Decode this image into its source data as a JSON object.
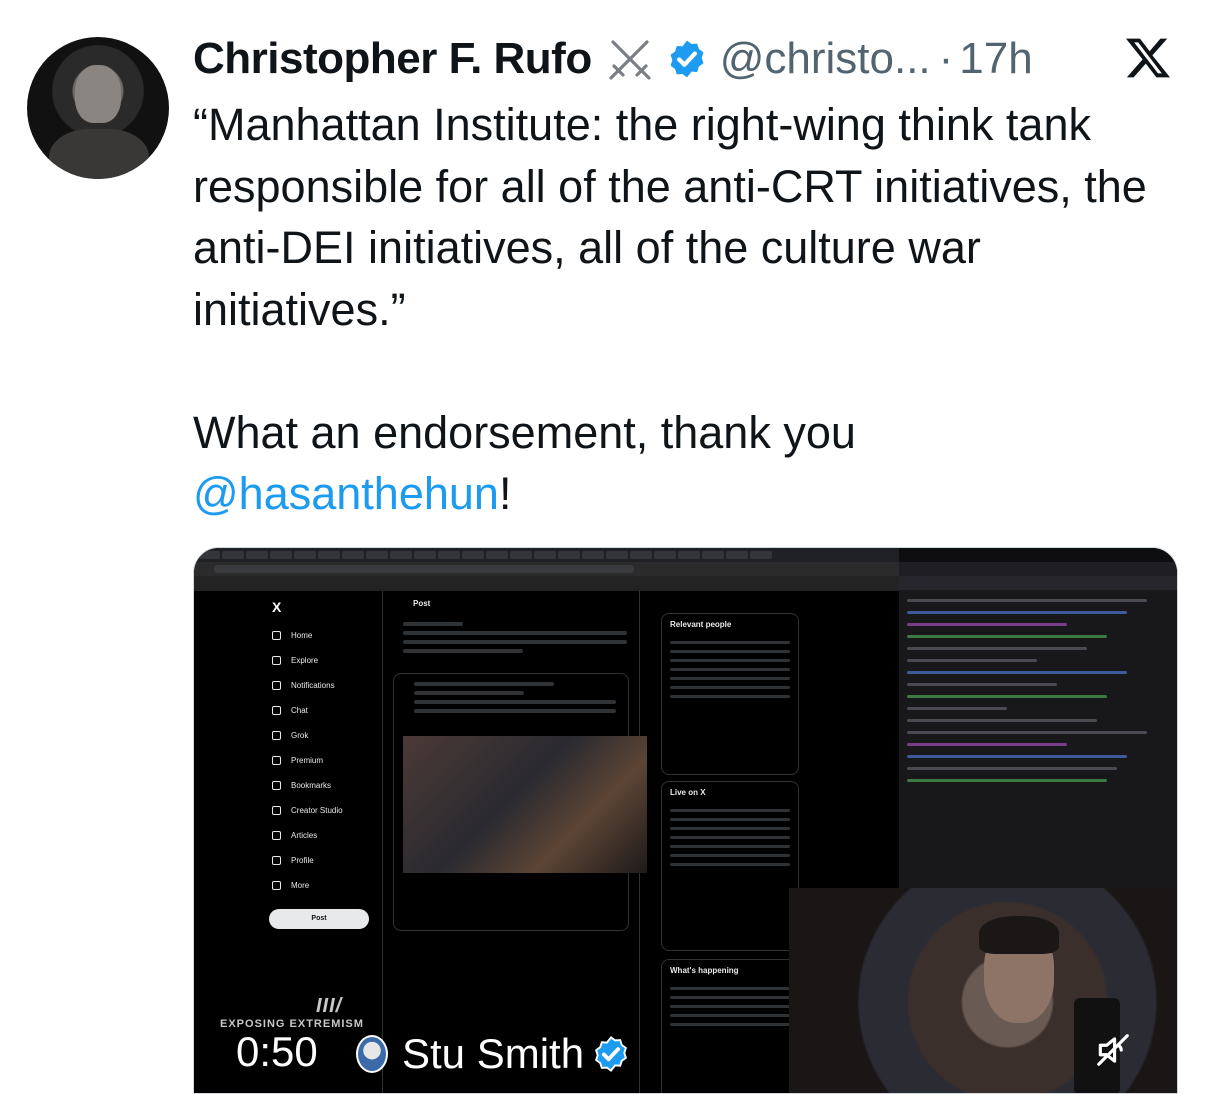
{
  "author": {
    "name": "Christopher F. Rufo",
    "handle": "@christo...",
    "separator": "·",
    "time": "17h"
  },
  "tweet": {
    "text": "“Manhattan Institute: the right-wing think tank responsible for all of the anti-CRT initiatives, the anti-DEI initiatives, all of the culture war initiatives.”\n\nWhat an endorsement, thank you ",
    "mention": "@hasanthehun",
    "trailing": "!"
  },
  "video": {
    "current_time": "0:50",
    "author_name": "Stu Smith",
    "overlay_bars": "III/",
    "overlay_text": "EXPOSING EXTREMISM"
  },
  "embedded_x": {
    "logo": "X",
    "nav": [
      "Home",
      "Explore",
      "Notifications",
      "Chat",
      "Grok",
      "Premium",
      "Bookmarks",
      "Creator Studio",
      "Articles",
      "Profile",
      "More"
    ],
    "post_button": "Post",
    "column_header": "Post",
    "relevant_people": "Relevant people",
    "live_on_x": "Live on X",
    "whats_happening": "What's happening"
  },
  "icons": {
    "swords": "crossed-swords-icon",
    "verified": "verified-badge-icon",
    "x_logo": "x-logo-icon",
    "mute": "muted-speaker-icon"
  },
  "colors": {
    "link": "#1d9bf0",
    "verified": "#1d9bf0",
    "secondary_text": "#536471"
  }
}
